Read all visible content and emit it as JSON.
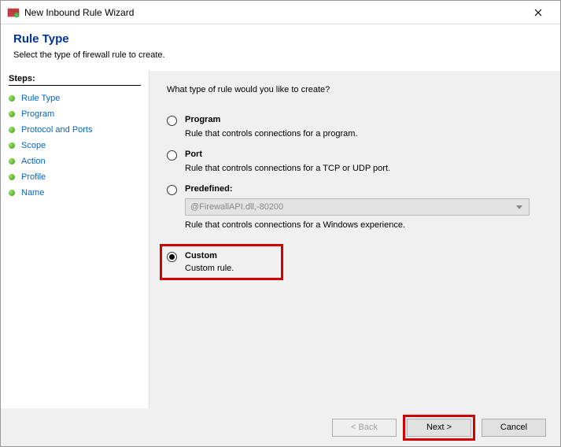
{
  "titlebar": {
    "title": "New Inbound Rule Wizard"
  },
  "header": {
    "title": "Rule Type",
    "subtitle": "Select the type of firewall rule to create."
  },
  "sidebar": {
    "heading": "Steps:",
    "items": [
      {
        "label": "Rule Type"
      },
      {
        "label": "Program"
      },
      {
        "label": "Protocol and Ports"
      },
      {
        "label": "Scope"
      },
      {
        "label": "Action"
      },
      {
        "label": "Profile"
      },
      {
        "label": "Name"
      }
    ]
  },
  "main": {
    "question": "What type of rule would you like to create?",
    "options": {
      "program": {
        "label": "Program",
        "desc": "Rule that controls connections for a program."
      },
      "port": {
        "label": "Port",
        "desc": "Rule that controls connections for a TCP or UDP port."
      },
      "predefined": {
        "label": "Predefined:",
        "select_value": "@FirewallAPI.dll,-80200",
        "desc": "Rule that controls connections for a Windows experience."
      },
      "custom": {
        "label": "Custom",
        "desc": "Custom rule."
      }
    }
  },
  "footer": {
    "back": "< Back",
    "next": "Next >",
    "cancel": "Cancel"
  }
}
